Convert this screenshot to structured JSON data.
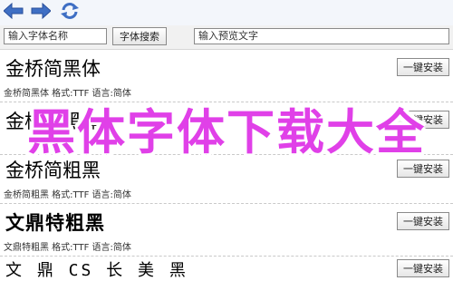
{
  "toolbar": {
    "font_name_input": "输入字体名称",
    "search_button": "字体搜索",
    "preview_input": "输入预览文字"
  },
  "fonts": [
    {
      "name": "金桥简黑体",
      "meta": "金桥简黑体  格式:TTF 语言:简体",
      "button": "一键安装"
    },
    {
      "name": "金桥简黑体",
      "meta": "",
      "button": "一键安装"
    },
    {
      "name": "金桥简粗黑",
      "meta": "金桥简粗黑  格式:TTF 语言:简体",
      "button": "一键安装"
    },
    {
      "name": "文鼎特粗黑",
      "meta": "文鼎特粗黑  格式:TTF 语言:简体",
      "button": "一键安装"
    },
    {
      "name": "文 鼎 CS 长 美 黑",
      "meta": "",
      "button": "一键安装"
    }
  ],
  "overlay_title": "黑体字体下载大全",
  "colors": {
    "nav_icon": "#3f6fc4",
    "overlay_text": "#e040e8",
    "panel_bg": "#f1f1f1"
  }
}
